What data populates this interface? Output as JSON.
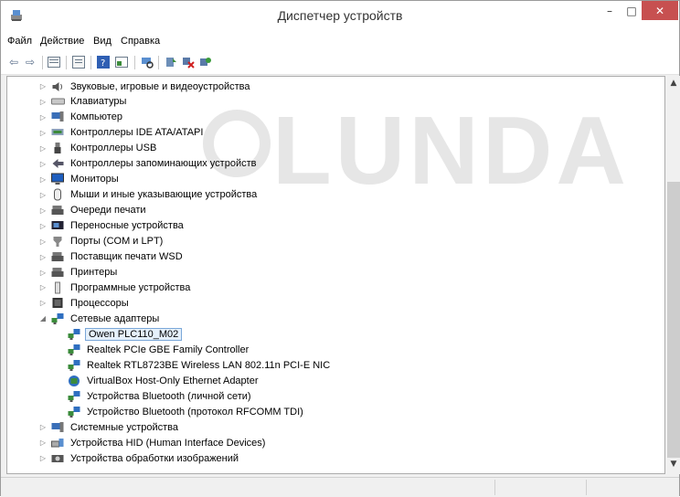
{
  "window": {
    "title": "Диспетчер устройств"
  },
  "menu": [
    "Файл",
    "Действие",
    "Вид",
    "Справка"
  ],
  "watermark": "LUNDA",
  "toolbar_icons": [
    "back-icon",
    "forward-icon",
    "tree-view-icon",
    "properties-icon",
    "help-icon",
    "show-hidden-icon",
    "scan-hardware-icon",
    "update-driver-icon",
    "disable-device-icon",
    "uninstall-icon"
  ],
  "tree": [
    {
      "label": "Звуковые, игровые и видеоустройства",
      "icon": "speaker-icon",
      "level": 0,
      "expand": "collapsed"
    },
    {
      "label": "Клавиатуры",
      "icon": "keyboard-icon",
      "level": 0,
      "expand": "collapsed"
    },
    {
      "label": "Компьютер",
      "icon": "computer-icon",
      "level": 0,
      "expand": "collapsed"
    },
    {
      "label": "Контроллеры IDE ATA/ATAPI",
      "icon": "ide-controller-icon",
      "level": 0,
      "expand": "collapsed"
    },
    {
      "label": "Контроллеры USB",
      "icon": "usb-icon",
      "level": 0,
      "expand": "collapsed"
    },
    {
      "label": "Контроллеры запоминающих устройств",
      "icon": "storage-controller-icon",
      "level": 0,
      "expand": "collapsed"
    },
    {
      "label": "Мониторы",
      "icon": "monitor-icon",
      "level": 0,
      "expand": "collapsed"
    },
    {
      "label": "Мыши и иные указывающие устройства",
      "icon": "mouse-icon",
      "level": 0,
      "expand": "collapsed"
    },
    {
      "label": "Очереди печати",
      "icon": "print-queue-icon",
      "level": 0,
      "expand": "collapsed"
    },
    {
      "label": "Переносные устройства",
      "icon": "portable-device-icon",
      "level": 0,
      "expand": "collapsed"
    },
    {
      "label": "Порты (COM и LPT)",
      "icon": "port-icon",
      "level": 0,
      "expand": "collapsed"
    },
    {
      "label": "Поставщик печати WSD",
      "icon": "wsd-printer-icon",
      "level": 0,
      "expand": "collapsed"
    },
    {
      "label": "Принтеры",
      "icon": "printer-icon",
      "level": 0,
      "expand": "collapsed"
    },
    {
      "label": "Программные устройства",
      "icon": "software-device-icon",
      "level": 0,
      "expand": "collapsed"
    },
    {
      "label": "Процессоры",
      "icon": "processor-icon",
      "level": 0,
      "expand": "collapsed"
    },
    {
      "label": "Сетевые адаптеры",
      "icon": "network-adapter-icon",
      "level": 0,
      "expand": "expanded"
    },
    {
      "label": "Owen PLC110_M02",
      "icon": "network-adapter-icon",
      "level": 1,
      "expand": "none",
      "selected": true
    },
    {
      "label": "Realtek PCIe GBE Family Controller",
      "icon": "network-adapter-icon",
      "level": 1,
      "expand": "none"
    },
    {
      "label": "Realtek RTL8723BE Wireless LAN 802.11n PCI-E NIC",
      "icon": "network-adapter-icon",
      "level": 1,
      "expand": "none"
    },
    {
      "label": "VirtualBox Host-Only Ethernet Adapter",
      "icon": "virtualbox-adapter-icon",
      "level": 1,
      "expand": "none"
    },
    {
      "label": "Устройства Bluetooth (личной сети)",
      "icon": "network-adapter-icon",
      "level": 1,
      "expand": "none"
    },
    {
      "label": "Устройство Bluetooth (протокол RFCOMM TDI)",
      "icon": "network-adapter-icon",
      "level": 1,
      "expand": "none"
    },
    {
      "label": "Системные устройства",
      "icon": "system-device-icon",
      "level": 0,
      "expand": "collapsed"
    },
    {
      "label": "Устройства HID (Human Interface Devices)",
      "icon": "hid-icon",
      "level": 0,
      "expand": "collapsed"
    },
    {
      "label": "Устройства обработки изображений",
      "icon": "imaging-device-icon",
      "level": 0,
      "expand": "collapsed"
    }
  ],
  "scrollbar": {
    "position": 0.27,
    "visible_fraction": 0.73
  }
}
